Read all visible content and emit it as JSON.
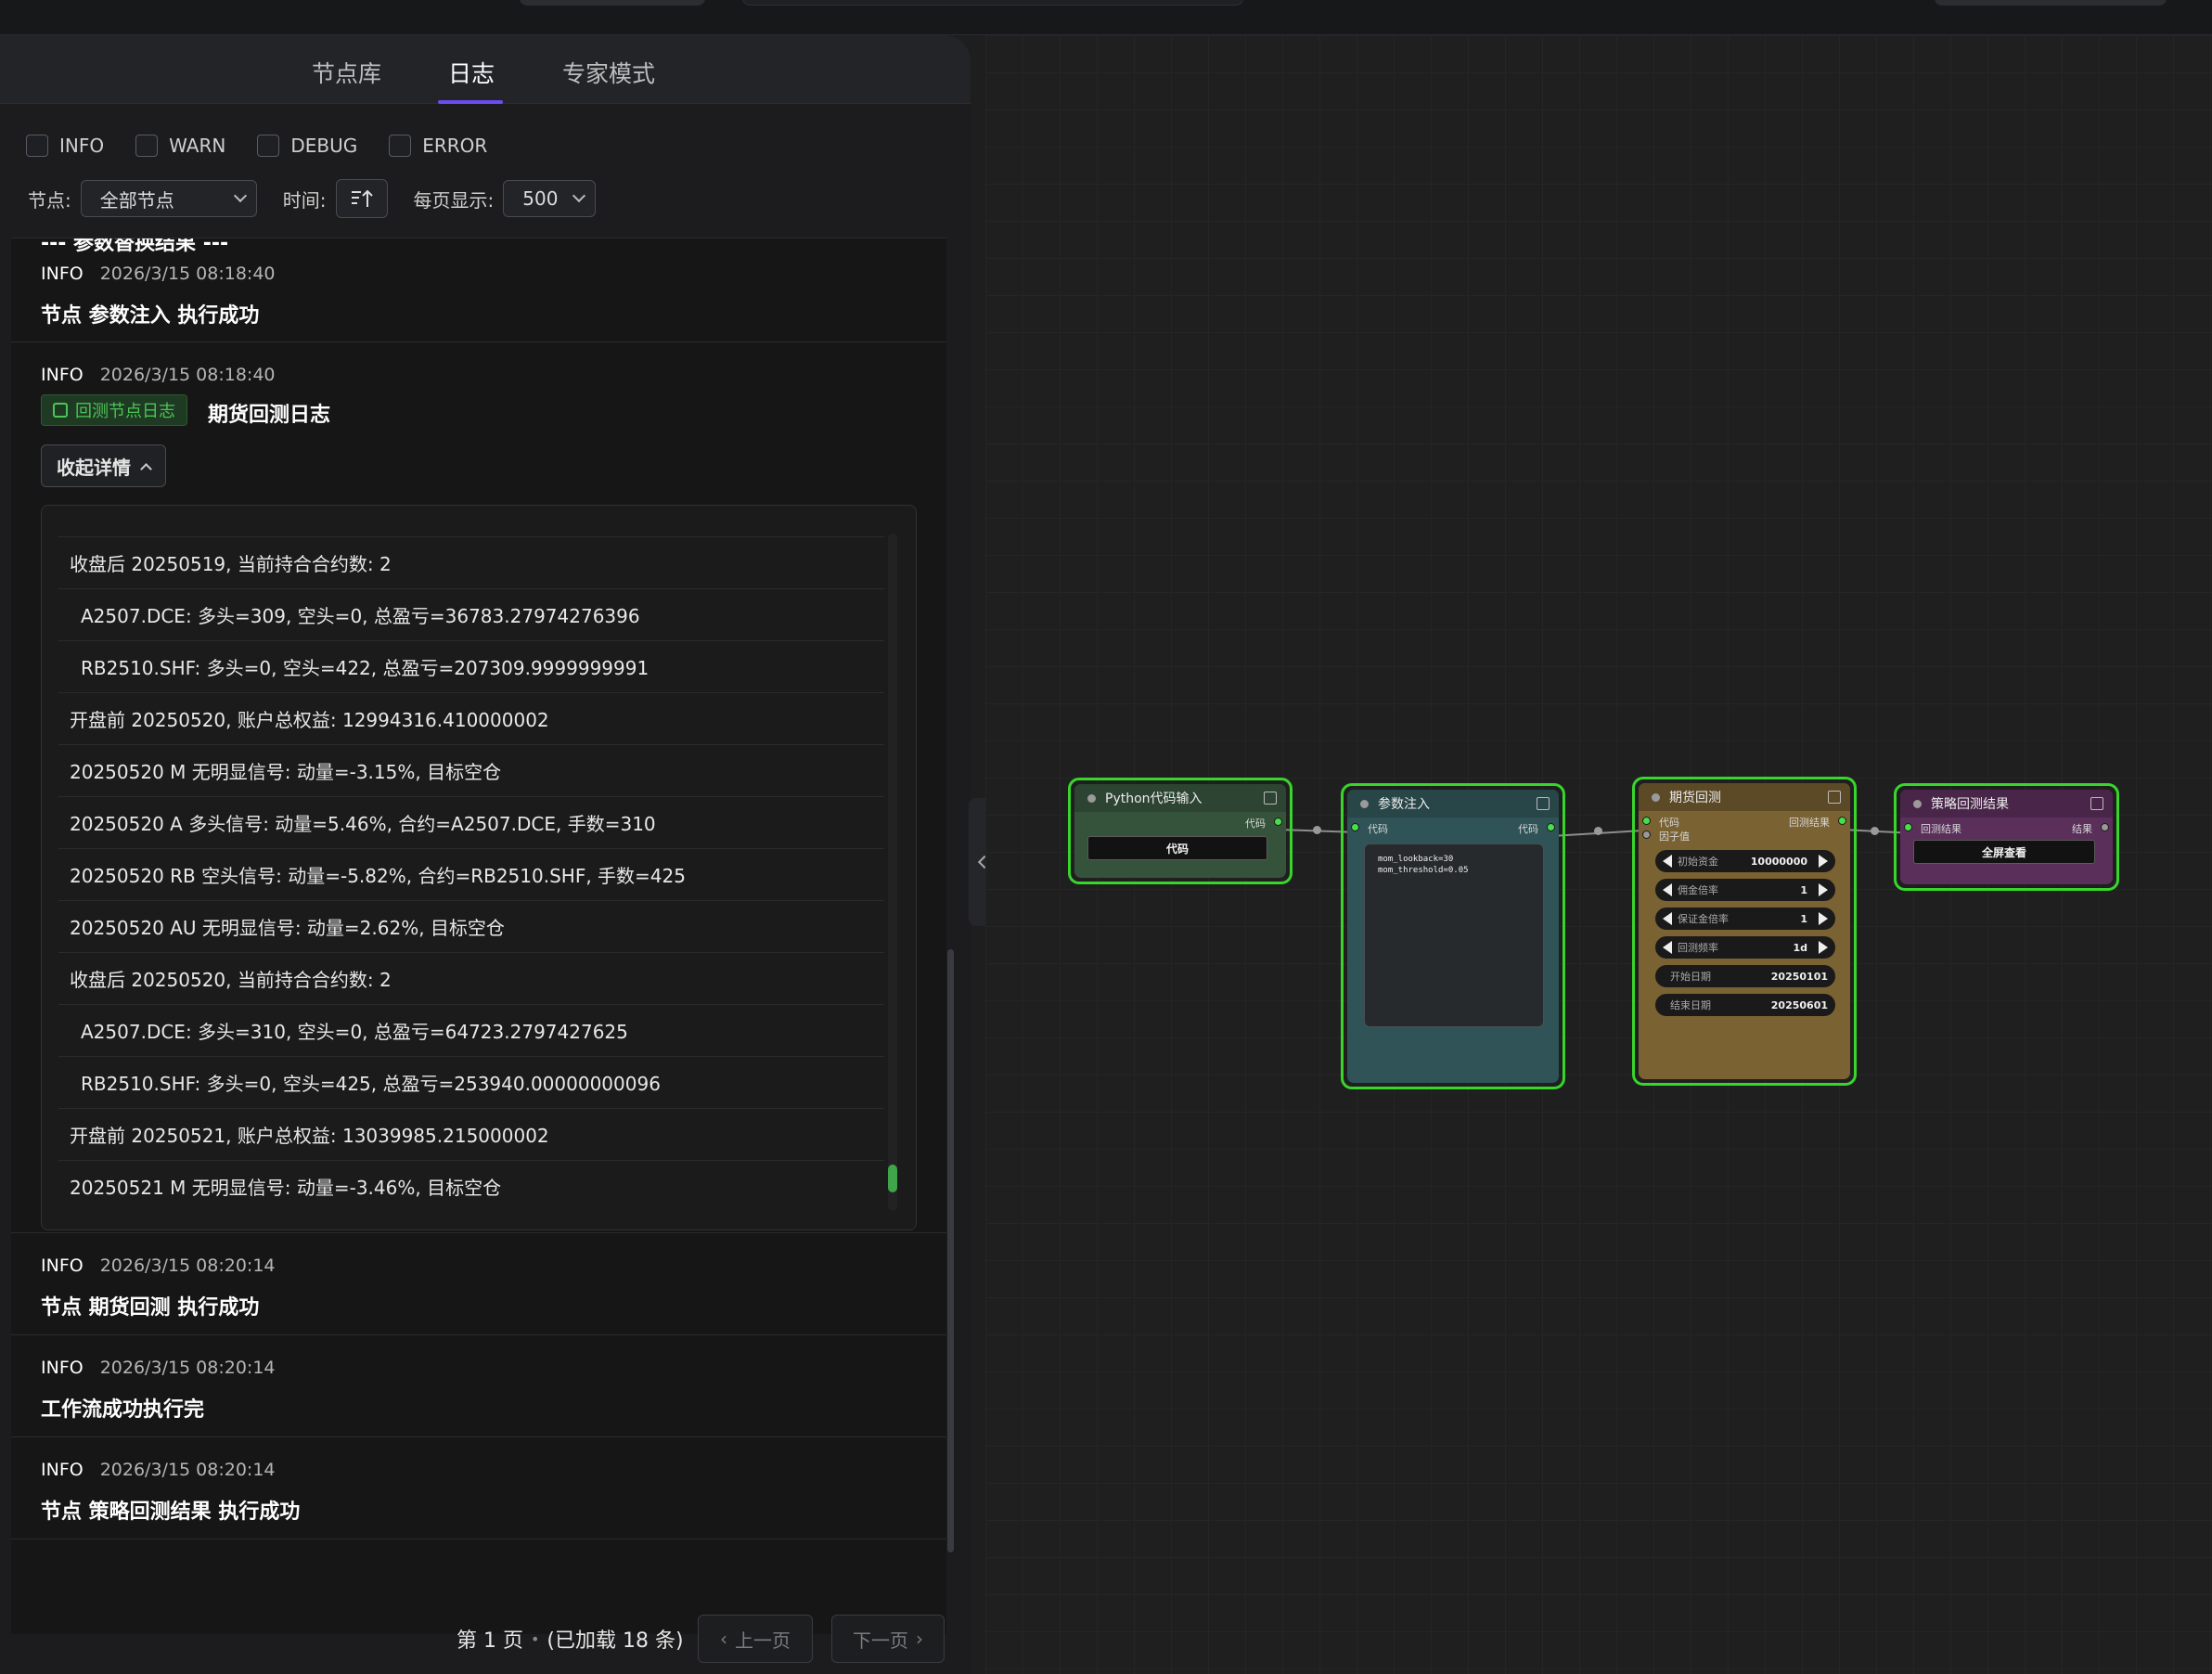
{
  "tabs": [
    {
      "label": "节点库"
    },
    {
      "label": "日志"
    },
    {
      "label": "专家模式"
    }
  ],
  "filters": [
    {
      "label": "INFO",
      "checked": false
    },
    {
      "label": "WARN",
      "checked": false
    },
    {
      "label": "DEBUG",
      "checked": false
    },
    {
      "label": "ERROR",
      "checked": false
    }
  ],
  "controls": {
    "node_label": "节点:",
    "node_value": "全部节点",
    "time_label": "时间:",
    "page_size_label": "每页显示:",
    "page_size_value": "500"
  },
  "log": {
    "partial_top": "--- 参数替换结果 ---",
    "entries": [
      {
        "level": "INFO",
        "time": "2026/3/15 08:18:40",
        "message": "节点 参数注入 执行成功"
      },
      {
        "level": "INFO",
        "time": "2026/3/15 08:18:40",
        "badge": "回测节点日志",
        "message": "期货回测日志",
        "collapse_label": "收起详情"
      },
      {
        "level": "INFO",
        "time": "2026/3/15 08:20:14",
        "message": "节点 期货回测 执行成功"
      },
      {
        "level": "INFO",
        "time": "2026/3/15 08:20:14",
        "message": "工作流成功执行完"
      },
      {
        "level": "INFO",
        "time": "2026/3/15 08:20:14",
        "message": "节点 策略回测结果 执行成功"
      }
    ],
    "detail_lines": [
      "收盘后 20250519, 当前持合合约数: 2",
      "A2507.DCE: 多头=309, 空头=0, 总盈亏=36783.27974276396",
      "RB2510.SHF: 多头=0, 空头=422, 总盈亏=207309.9999999991",
      "开盘前 20250520, 账户总权益: 12994316.410000002",
      "20250520 M 无明显信号: 动量=-3.15%, 目标空仓",
      "20250520 A 多头信号: 动量=5.46%, 合约=A2507.DCE, 手数=310",
      "20250520 RB 空头信号: 动量=-5.82%, 合约=RB2510.SHF, 手数=425",
      "20250520 AU 无明显信号: 动量=2.62%, 目标空仓",
      "收盘后 20250520, 当前持合合约数: 2",
      "A2507.DCE: 多头=310, 空头=0, 总盈亏=64723.2797427625",
      "RB2510.SHF: 多头=0, 空头=425, 总盈亏=253940.00000000096",
      "开盘前 20250521, 账户总权益: 13039985.215000002",
      "20250521 M 无明显信号: 动量=-3.46%, 目标空仓"
    ]
  },
  "pager": {
    "page_text": "第 1 页",
    "sep": "•",
    "loaded_text": "(已加载 18 条)",
    "prev_label": "上一页",
    "next_label": "下一页"
  },
  "nodes": {
    "python": {
      "title": "Python代码输入",
      "out_label": "代码",
      "button": "代码"
    },
    "param": {
      "title": "参数注入",
      "in_label": "代码",
      "out_label": "代码",
      "code_line1": "mom_lookback=30",
      "code_line2": "mom_threshold=0.05"
    },
    "backtest": {
      "title": "期货回测",
      "in_code": "代码",
      "in_factor": "因子值",
      "out_label": "回测结果",
      "widgets": [
        {
          "label": "初始资金",
          "value": "10000000"
        },
        {
          "label": "佣金倍率",
          "value": "1"
        },
        {
          "label": "保证金倍率",
          "value": "1"
        },
        {
          "label": "回测频率",
          "value": "1d"
        },
        {
          "label": "开始日期",
          "value": "20250101"
        },
        {
          "label": "结束日期",
          "value": "20250601"
        }
      ]
    },
    "result": {
      "title": "策略回测结果",
      "in_label": "回测结果",
      "out_label": "结果",
      "button": "全屏查看"
    }
  },
  "colors": {
    "accent": "#6b4cf0",
    "node_border": "#38d62b",
    "badge_green": "#4cc458",
    "python_node": "#35523a",
    "param_node": "#2f5356",
    "backtest_node": "#7a6233",
    "result_node": "#5a2f5a"
  }
}
